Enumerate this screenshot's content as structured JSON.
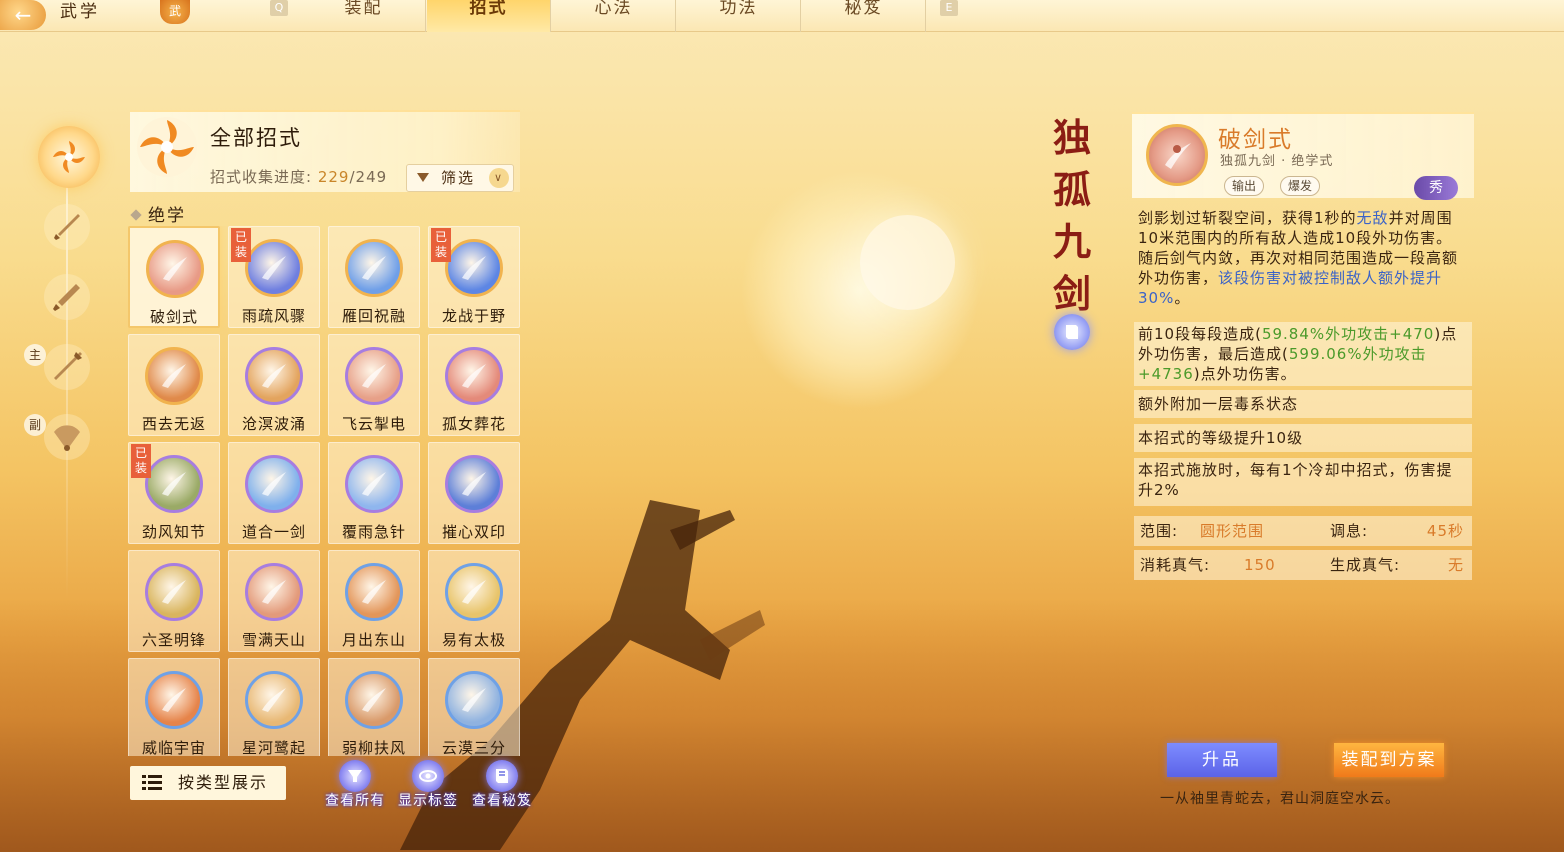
{
  "topbar": {
    "title": "武学",
    "emblem": "武",
    "key_left": "Q",
    "key_right": "E",
    "tabs": [
      {
        "label": "装配",
        "active": false
      },
      {
        "label": "招式",
        "active": true
      },
      {
        "label": "心法",
        "active": false
      },
      {
        "label": "功法",
        "active": false
      },
      {
        "label": "秘笈",
        "active": false
      }
    ]
  },
  "leftnav": {
    "badge_main": "主",
    "badge_sub": "副",
    "icons": [
      "flower-emblem-icon",
      "sword-icon",
      "blade-icon",
      "spear-icon",
      "fan-icon"
    ]
  },
  "moves_panel": {
    "title": "全部招式",
    "progress_label": "招式收集进度:",
    "progress_current": "229",
    "progress_total": "/249",
    "filter_label": "筛选",
    "section": "绝学",
    "equipped_text": "已装",
    "moves": [
      {
        "name": "破剑式",
        "selected": true,
        "equipped": false,
        "ring": "#f1b34e",
        "fill": "#e89a86"
      },
      {
        "name": "雨疏风骤",
        "selected": false,
        "equipped": true,
        "ring": "#f1b34e",
        "fill": "#6f7fe0"
      },
      {
        "name": "雁回祝融",
        "selected": false,
        "equipped": false,
        "ring": "#f1b34e",
        "fill": "#6f9fe8"
      },
      {
        "name": "龙战于野",
        "selected": false,
        "equipped": true,
        "ring": "#f1b34e",
        "fill": "#5d86e4"
      },
      {
        "name": "西去无返",
        "selected": false,
        "equipped": false,
        "ring": "#f1b34e",
        "fill": "#e08a4a"
      },
      {
        "name": "沧溟波涌",
        "selected": false,
        "equipped": false,
        "ring": "#a77de0",
        "fill": "#e3a45e"
      },
      {
        "name": "飞云掣电",
        "selected": false,
        "equipped": false,
        "ring": "#a77de0",
        "fill": "#e7a088"
      },
      {
        "name": "孤女葬花",
        "selected": false,
        "equipped": false,
        "ring": "#a77de0",
        "fill": "#e48a7a"
      },
      {
        "name": "劲风知节",
        "selected": false,
        "equipped": true,
        "ring": "#a77de0",
        "fill": "#9aaa66"
      },
      {
        "name": "道合一剑",
        "selected": false,
        "equipped": false,
        "ring": "#a77de0",
        "fill": "#7fb0ec"
      },
      {
        "name": "覆雨急针",
        "selected": false,
        "equipped": false,
        "ring": "#a77de0",
        "fill": "#8fb6ee"
      },
      {
        "name": "摧心双印",
        "selected": false,
        "equipped": false,
        "ring": "#a77de0",
        "fill": "#5d7fd8"
      },
      {
        "name": "六圣明锋",
        "selected": false,
        "equipped": false,
        "ring": "#a77de0",
        "fill": "#d9b55e"
      },
      {
        "name": "雪满天山",
        "selected": false,
        "equipped": false,
        "ring": "#a77de0",
        "fill": "#e39a7a"
      },
      {
        "name": "月出东山",
        "selected": false,
        "equipped": false,
        "ring": "#6fa1e6",
        "fill": "#e3965a"
      },
      {
        "name": "易有太极",
        "selected": false,
        "equipped": false,
        "ring": "#6fa1e6",
        "fill": "#e8c46a"
      },
      {
        "name": "威临宇宙",
        "selected": false,
        "equipped": false,
        "ring": "#6fa1e6",
        "fill": "#e6844a"
      },
      {
        "name": "星河鹭起",
        "selected": false,
        "equipped": false,
        "ring": "#6fa1e6",
        "fill": "#e8b874"
      },
      {
        "name": "弱柳扶风",
        "selected": false,
        "equipped": false,
        "ring": "#6fa1e6",
        "fill": "#d99a6a"
      },
      {
        "name": "云漠三分",
        "selected": false,
        "equipped": false,
        "ring": "#6fa1e6",
        "fill": "#8fb2e0"
      }
    ],
    "view_toggle": "按类型展示",
    "actions": [
      {
        "label": "查看所有",
        "icon": "funnel-icon"
      },
      {
        "label": "显示标签",
        "icon": "eye-tag-icon"
      },
      {
        "label": "查看秘笈",
        "icon": "book-icon"
      }
    ]
  },
  "detail": {
    "school_vertical": "独孤九剑",
    "name": "破剑式",
    "subtitle": "独孤九剑 · 绝学式",
    "tags": [
      "输出",
      "爆发"
    ],
    "rarity_badge": "秀",
    "desc_p1_a": "剑影划过斩裂空间，获得1秒的",
    "desc_p1_b": "无敌",
    "desc_p1_c": "并对周围10米范围内的所有敌人造成10段外功伤害。随后剑气内敛，再次对相同范围造成一段高额外功伤害，",
    "desc_p1_d": "该段伤害对被控制敌人额外提升30%",
    "desc_p1_e": "。",
    "desc_p2_a": "前10段每段造成(",
    "desc_p2_b": "59.84%外功攻击+470",
    "desc_p2_c": ")点外功伤害，最后造成(",
    "desc_p2_d": "599.06%外功攻击+4736",
    "desc_p2_e": ")点外功伤害。",
    "effect_1": "额外附加一层毒系状态",
    "effect_2": "本招式的等级提升10级",
    "effect_3": "本招式施放时，每有1个冷却中招式，伤害提升2%",
    "stats": {
      "range_label": "范围:",
      "range_value": "圆形范围",
      "cooldown_label": "调息:",
      "cooldown_value": "45秒",
      "cost_label": "消耗真气:",
      "cost_value": "150",
      "gen_label": "生成真气:",
      "gen_value": "无"
    },
    "upgrade_button": "升品",
    "equip_button": "装配到方案",
    "poem": "一从袖里青蛇去，君山洞庭空水云。"
  }
}
